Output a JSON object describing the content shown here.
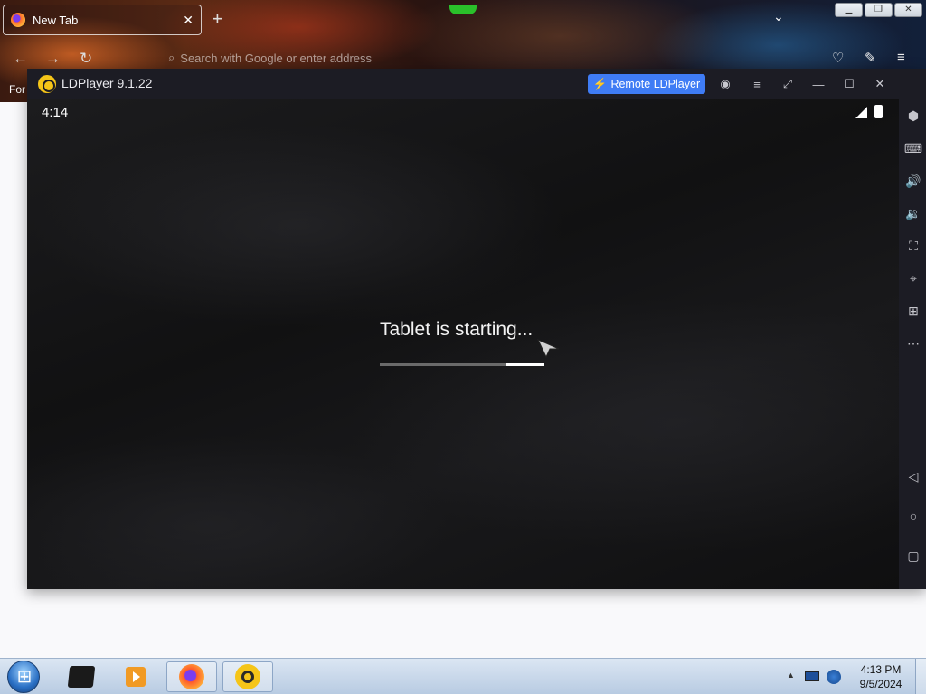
{
  "browser": {
    "tab_title": "New Tab",
    "tab_close": "✕",
    "new_tab": "+",
    "url_placeholder": "Search with Google or enter address",
    "bookmark_partial": "For"
  },
  "ldplayer": {
    "title": "LDPlayer 9.1.22",
    "remote_button": "Remote LDPlayer",
    "status_time": "4:14",
    "boot_text": "Tablet is starting...",
    "boot_progress": 0.23,
    "sidebar_icons": [
      "gamepad-icon",
      "keyboard-icon",
      "volume-up-icon",
      "volume-down-icon",
      "screenshot-icon",
      "gps-icon",
      "add-app-icon",
      "more-icon",
      "back-icon",
      "home-icon",
      "recent-apps-icon"
    ]
  },
  "taskbar": {
    "time": "4:13 PM",
    "date": "9/5/2024"
  },
  "colors": {
    "remote_button": "#3f7cf5",
    "ld_logo": "#f5c518",
    "window_bg": "#1c1c24"
  }
}
